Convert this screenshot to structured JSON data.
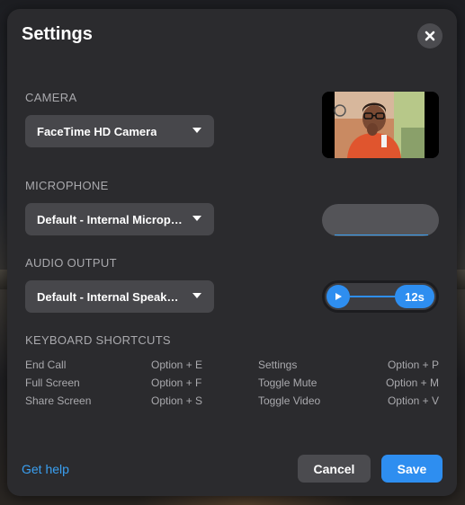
{
  "dialog": {
    "title": "Settings"
  },
  "camera": {
    "label": "CAMERA",
    "selected": "FaceTime HD Camera"
  },
  "microphone": {
    "label": "MICROPHONE",
    "selected": "Default - Internal Microp…"
  },
  "audio_output": {
    "label": "AUDIO OUTPUT",
    "selected": "Default - Internal Speak…",
    "test_duration": "12s"
  },
  "shortcuts": {
    "label": "KEYBOARD SHORTCUTS",
    "items": [
      {
        "action": "End Call",
        "keys": "Option + E"
      },
      {
        "action": "Full Screen",
        "keys": "Option + F"
      },
      {
        "action": "Share Screen",
        "keys": "Option + S"
      },
      {
        "action": "Settings",
        "keys": "Option + P"
      },
      {
        "action": "Toggle Mute",
        "keys": "Option + M"
      },
      {
        "action": "Toggle Video",
        "keys": "Option + V"
      }
    ]
  },
  "footer": {
    "help_link": "Get help",
    "cancel_label": "Cancel",
    "save_label": "Save"
  },
  "colors": {
    "accent": "#2e8ef0",
    "panel": "#2b2b2e",
    "control": "#47474b"
  }
}
